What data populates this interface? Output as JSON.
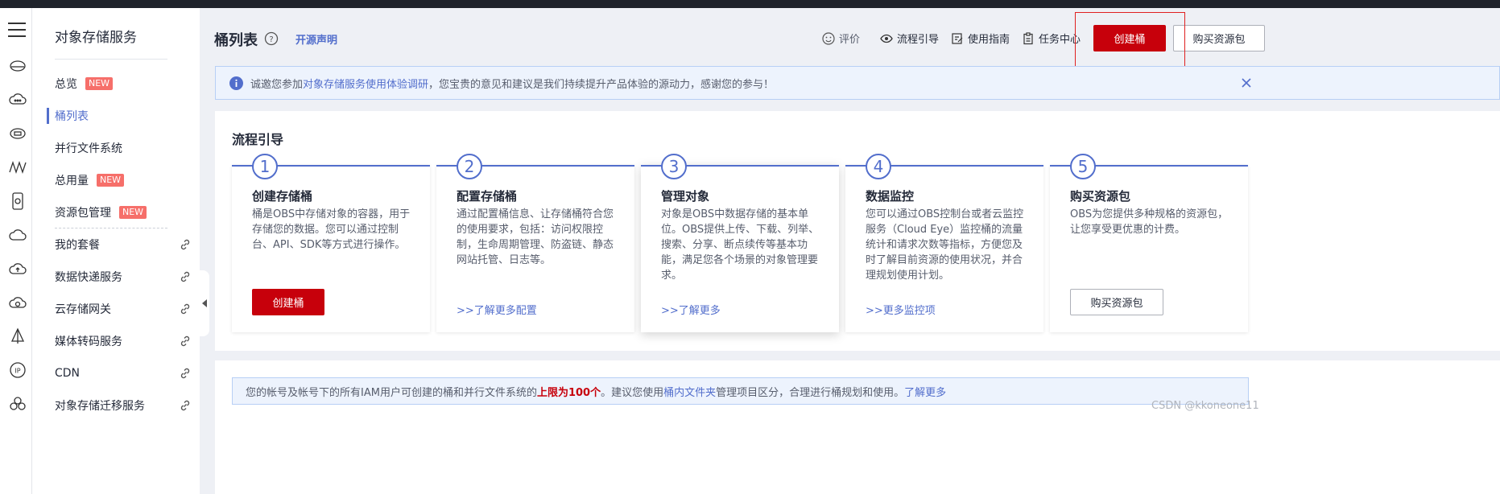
{
  "sidebar": {
    "service_title": "对象存储服务",
    "items": [
      {
        "label": "总览",
        "badge": "NEW"
      },
      {
        "label": "桶列表"
      },
      {
        "label": "并行文件系统"
      },
      {
        "label": "总用量",
        "badge": "NEW"
      },
      {
        "label": "资源包管理",
        "badge": "NEW"
      },
      {
        "label": "我的套餐"
      },
      {
        "label": "数据快递服务"
      },
      {
        "label": "云存储网关"
      },
      {
        "label": "媒体转码服务"
      },
      {
        "label": "CDN"
      },
      {
        "label": "对象存储迁移服务"
      }
    ]
  },
  "header": {
    "title": "桶列表",
    "open_source": "开源声明",
    "tools": {
      "rate": "评价",
      "flow_guide": "流程引导",
      "usage_guide": "使用指南",
      "task_center": "任务中心"
    },
    "create_bucket": "创建桶",
    "buy_package": "购买资源包"
  },
  "notice": {
    "prefix": "诚邀您参加",
    "link": "对象存储服务使用体验调研",
    "suffix": "，您宝贵的意见和建议是我们持续提升产品体验的源动力，感谢您的参与！"
  },
  "flow": {
    "title": "流程引导",
    "steps": [
      {
        "num": "1",
        "title": "创建存储桶",
        "desc": "桶是OBS中存储对象的容器，用于存储您的数据。您可以通过控制台、API、SDK等方式进行操作。",
        "action": "创建桶"
      },
      {
        "num": "2",
        "title": "配置存储桶",
        "desc": "通过配置桶信息、让存储桶符合您的使用要求，包括：访问权限控制，生命周期管理、防盗链、静态网站托管、日志等。",
        "link": ">>了解更多配置"
      },
      {
        "num": "3",
        "title": "管理对象",
        "desc": "对象是OBS中数据存储的基本单位。OBS提供上传、下载、列举、搜索、分享、断点续传等基本功能，满足您各个场景的对象管理要求。",
        "link": ">>了解更多"
      },
      {
        "num": "4",
        "title": "数据监控",
        "desc": "您可以通过OBS控制台或者云监控服务（Cloud Eye）监控桶的流量统计和请求次数等指标，方便您及时了解目前资源的使用状况，并合理规划使用计划。",
        "link": ">>更多监控项"
      },
      {
        "num": "5",
        "title": "购买资源包",
        "desc": "OBS为您提供多种规格的资源包，让您享受更优惠的计费。",
        "action": "购买资源包"
      }
    ]
  },
  "limit": {
    "prefix": "您的帐号及帐号下的所有IAM用户可创建的桶和并行文件系统的",
    "highlight": "上限为100个",
    "middle": "。建议您使用",
    "link1": "桶内文件夹",
    "suffix": "管理项目区分，合理进行桶规划和使用。",
    "link2": "了解更多"
  },
  "watermark": "CSDN @kkoneone11",
  "colors": {
    "brand_red": "#c7000b",
    "link_blue": "#526ecc",
    "notice_bg": "#edf3fd"
  }
}
